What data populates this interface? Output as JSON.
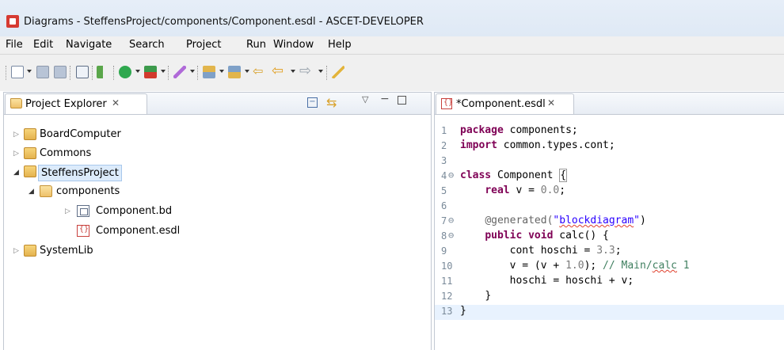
{
  "window": {
    "title": "Diagrams - SteffensProject/components/Component.esdl - ASCET-DEVELOPER"
  },
  "menu": [
    "File",
    "Edit",
    "Navigate",
    "Search",
    "Project",
    "Run",
    "Window",
    "Help"
  ],
  "toolbar": {
    "icons": [
      "new-icon",
      "save-icon",
      "save-all-icon",
      "build-icon",
      "debug-run-icon",
      "run-icon",
      "external-tool-icon",
      "annotation-icon",
      "next-annotation-icon",
      "prev-annotation-icon",
      "last-edit-icon",
      "back-icon",
      "forward-icon",
      "pen-icon"
    ]
  },
  "project_explorer": {
    "tab_label": "Project Explorer",
    "tree": [
      {
        "label": "BoardComputer",
        "level": 0,
        "type": "project",
        "expanded": false
      },
      {
        "label": "Commons",
        "level": 0,
        "type": "project",
        "expanded": false
      },
      {
        "label": "SteffensProject",
        "level": 0,
        "type": "project",
        "expanded": true,
        "selected": true
      },
      {
        "label": "components",
        "level": 1,
        "type": "folder",
        "expanded": true
      },
      {
        "label": "Component.bd",
        "level": 2,
        "type": "bd",
        "expanded": false
      },
      {
        "label": "Component.esdl",
        "level": 2,
        "type": "esdl"
      },
      {
        "label": "SystemLib",
        "level": 0,
        "type": "project",
        "expanded": false
      }
    ]
  },
  "editor": {
    "tab_label": "*Component.esdl",
    "current_line": 13,
    "lines": [
      {
        "n": "1",
        "fold": ""
      },
      {
        "n": "2",
        "fold": ""
      },
      {
        "n": "3",
        "fold": ""
      },
      {
        "n": "4",
        "fold": "⊖"
      },
      {
        "n": "5",
        "fold": ""
      },
      {
        "n": "6",
        "fold": ""
      },
      {
        "n": "7",
        "fold": "⊖"
      },
      {
        "n": "8",
        "fold": "⊖"
      },
      {
        "n": "9",
        "fold": ""
      },
      {
        "n": "10",
        "fold": ""
      },
      {
        "n": "11",
        "fold": ""
      },
      {
        "n": "12",
        "fold": ""
      },
      {
        "n": "13",
        "fold": ""
      }
    ],
    "code": {
      "l1_kw": "package",
      "l1_rest": " components;",
      "l2_kw": "import",
      "l2_rest": " common.types.cont;",
      "l4_kw": "class",
      "l4_rest": " Component ",
      "l4_brace": "{",
      "l5_indent": "    ",
      "l5_kw": "real",
      "l5_rest": " v = ",
      "l5_num": "0.0",
      "l5_end": ";",
      "l7_indent": "    ",
      "l7_ann": "@generated(",
      "l7_str_a": "\"",
      "l7_str_b": "blockdiagram",
      "l7_str_c": "\"",
      "l7_end": ")",
      "l8_indent": "    ",
      "l8_kw1": "public",
      "l8_sp": " ",
      "l8_kw2": "void",
      "l8_rest": " calc() {",
      "l9_indent": "        ",
      "l9_rest": "cont hoschi = ",
      "l9_num": "3.3",
      "l9_end": ";",
      "l10_indent": "        ",
      "l10_rest": "v = (v + ",
      "l10_num": "1.0",
      "l10_mid": "); ",
      "l10_cm_a": "// Main/",
      "l10_cm_b": "calc",
      "l10_cm_c": " 1",
      "l11_indent": "        ",
      "l11_rest": "hoschi = hoschi + v;",
      "l12_indent": "    ",
      "l12_rest": "}",
      "l13_rest": "}"
    }
  }
}
